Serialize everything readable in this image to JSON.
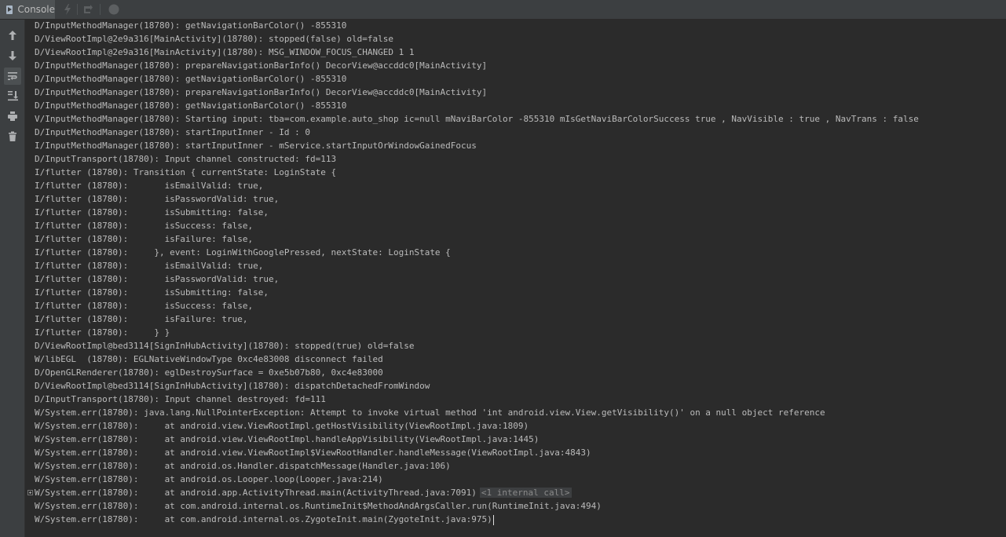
{
  "window": {
    "tab_label": "Console"
  },
  "toolbar_icons": [
    "lightning-icon",
    "rerun-icon",
    "stop-icon"
  ],
  "sidebar_icons": [
    "arrow-up-icon",
    "arrow-down-icon",
    "soft-wrap-icon",
    "scroll-to-end-icon",
    "print-icon",
    "trash-icon"
  ],
  "log": {
    "lines": [
      "D/InputMethodManager(18780): getNavigationBarColor() -855310",
      "D/ViewRootImpl@2e9a316[MainActivity](18780): stopped(false) old=false",
      "D/ViewRootImpl@2e9a316[MainActivity](18780): MSG_WINDOW_FOCUS_CHANGED 1 1",
      "D/InputMethodManager(18780): prepareNavigationBarInfo() DecorView@accddc0[MainActivity]",
      "D/InputMethodManager(18780): getNavigationBarColor() -855310",
      "D/InputMethodManager(18780): prepareNavigationBarInfo() DecorView@accddc0[MainActivity]",
      "D/InputMethodManager(18780): getNavigationBarColor() -855310",
      "V/InputMethodManager(18780): Starting input: tba=com.example.auto_shop ic=null mNaviBarColor -855310 mIsGetNaviBarColorSuccess true , NavVisible : true , NavTrans : false",
      "D/InputMethodManager(18780): startInputInner - Id : 0",
      "I/InputMethodManager(18780): startInputInner - mService.startInputOrWindowGainedFocus",
      "D/InputTransport(18780): Input channel constructed: fd=113",
      "I/flutter (18780): Transition { currentState: LoginState {",
      "I/flutter (18780):       isEmailValid: true,",
      "I/flutter (18780):       isPasswordValid: true,",
      "I/flutter (18780):       isSubmitting: false,",
      "I/flutter (18780):       isSuccess: false,",
      "I/flutter (18780):       isFailure: false,",
      "I/flutter (18780):     }, event: LoginWithGooglePressed, nextState: LoginState {",
      "I/flutter (18780):       isEmailValid: true,",
      "I/flutter (18780):       isPasswordValid: true,",
      "I/flutter (18780):       isSubmitting: false,",
      "I/flutter (18780):       isSuccess: false,",
      "I/flutter (18780):       isFailure: true,",
      "I/flutter (18780):     } }",
      "D/ViewRootImpl@bed3114[SignInHubActivity](18780): stopped(true) old=false",
      "W/libEGL  (18780): EGLNativeWindowType 0xc4e83008 disconnect failed",
      "D/OpenGLRenderer(18780): eglDestroySurface = 0xe5b07b80, 0xc4e83000",
      "D/ViewRootImpl@bed3114[SignInHubActivity](18780): dispatchDetachedFromWindow",
      "D/InputTransport(18780): Input channel destroyed: fd=111",
      "W/System.err(18780): java.lang.NullPointerException: Attempt to invoke virtual method 'int android.view.View.getVisibility()' on a null object reference",
      "W/System.err(18780):     at android.view.ViewRootImpl.getHostVisibility(ViewRootImpl.java:1809)",
      "W/System.err(18780):     at android.view.ViewRootImpl.handleAppVisibility(ViewRootImpl.java:1445)",
      "W/System.err(18780):     at android.view.ViewRootImpl$ViewRootHandler.handleMessage(ViewRootImpl.java:4843)",
      "W/System.err(18780):     at android.os.Handler.dispatchMessage(Handler.java:106)",
      "W/System.err(18780):     at android.os.Looper.loop(Looper.java:214)",
      "W/System.err(18780):     at android.app.ActivityThread.main(ActivityThread.java:7091)",
      "W/System.err(18780):     at com.android.internal.os.RuntimeInit$MethodAndArgsCaller.run(RuntimeInit.java:494)",
      "W/System.err(18780):     at com.android.internal.os.ZygoteInit.main(ZygoteInit.java:975)"
    ],
    "internal_call_label": "<1 internal call>",
    "internal_call_line_index": 35,
    "caret_line_index": 37
  }
}
